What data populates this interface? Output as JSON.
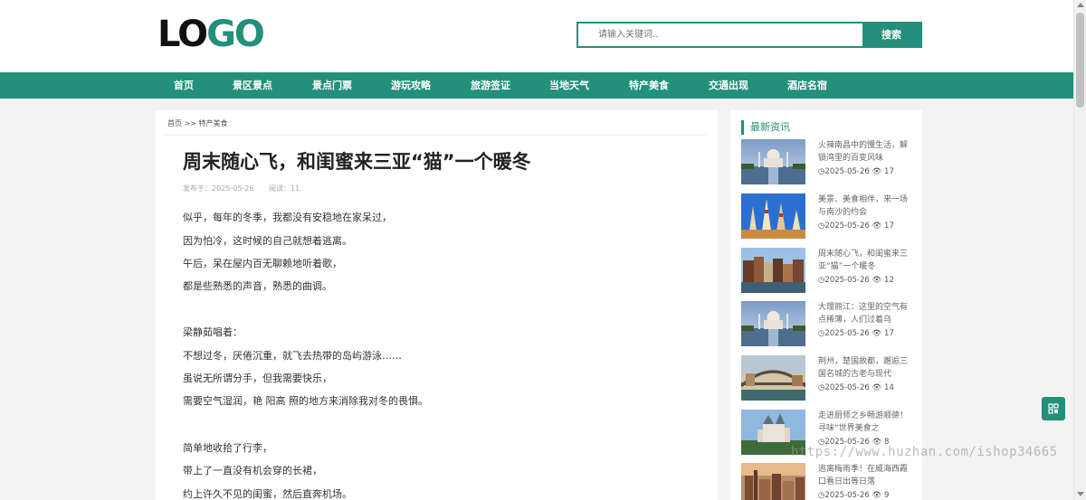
{
  "header": {
    "logo_part1": "LO",
    "logo_part2": "GO",
    "search_placeholder": "请输入关键词..",
    "search_button": "搜索"
  },
  "nav": {
    "items": [
      "首页",
      "景区景点",
      "景点门票",
      "游玩攻略",
      "旅游签证",
      "当地天气",
      "特产美食",
      "交通出现",
      "酒店名宿"
    ]
  },
  "breadcrumb": {
    "home": "首页",
    "sep": ">>",
    "current": "特产美食"
  },
  "article": {
    "title": "周末随心飞，和闺蜜来三亚“猫”一个暖冬",
    "publish_label": "发布于：2025-05-26",
    "views_label": "阅读：11",
    "lines": [
      "似乎，每年的冬季，我都没有安稳地在家呆过，",
      "因为怕冷，这时候的自己就想着逃离。",
      "午后，呆在屋内百无聊赖地听着歌，",
      "都是些熟悉的声音，熟悉的曲调。",
      "梁静茹唱着：",
      "不想过冬，厌倦沉重，就飞去热带的岛屿游泳……",
      "虽说无所谓分手，但我需要快乐，",
      "需要空气湿润，艳 阳高 照的地方来消除我对冬的畏惧。",
      "简单地收拾了行李，",
      "带上了一直没有机会穿的长裙，",
      "约上许久不见的闺蜜，然后直奔机场。"
    ]
  },
  "sidebar": {
    "heading": "最新资讯",
    "items": [
      {
        "title": "火辣南昌中的慢生活，解锁湾里的百变风味",
        "date": "2025-05-26",
        "views": "17",
        "scene": "taj"
      },
      {
        "title": "美景、美食相伴，来一场与南沙的约会",
        "date": "2025-05-26",
        "views": "17",
        "scene": "temple"
      },
      {
        "title": "周末随心飞，和闺蜜来三亚“猫”一个暖冬",
        "date": "2025-05-26",
        "views": "12",
        "scene": "canal"
      },
      {
        "title": "大理丽江：这里的空气有点稀薄，人们过着乌",
        "date": "2025-05-26",
        "views": "17",
        "scene": "taj"
      },
      {
        "title": "荆州，楚国故都，邂逅三国名城的古老与现代",
        "date": "2025-05-26",
        "views": "14",
        "scene": "bridge"
      },
      {
        "title": "走进厨师之乡畅游顺德！寻味“世界美食之",
        "date": "2025-05-26",
        "views": "8",
        "scene": "castle"
      },
      {
        "title": "逃离梅雨季！在威海西霞口看日出等日落",
        "date": "2025-05-26",
        "views": "9",
        "scene": "city"
      }
    ]
  },
  "watermark": "https://www.huzhan.com/ishop34665",
  "colors": {
    "brand": "#22907a",
    "background": "#f3f3f3"
  }
}
